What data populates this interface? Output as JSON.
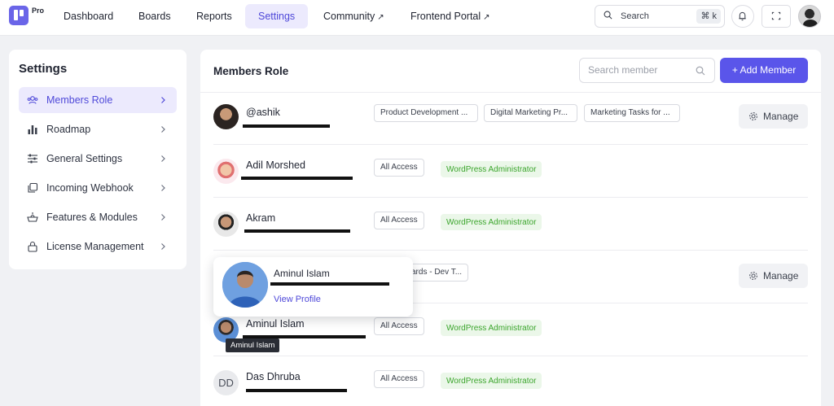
{
  "topbar": {
    "logo_badge": "Pro",
    "nav": [
      {
        "label": "Dashboard"
      },
      {
        "label": "Boards"
      },
      {
        "label": "Reports"
      },
      {
        "label": "Settings",
        "active": true
      },
      {
        "label": "Community",
        "external": "↗"
      },
      {
        "label": "Frontend Portal",
        "external": "↗"
      }
    ],
    "search_label": "Search",
    "search_shortcut": "⌘ k",
    "icons": [
      "bell-icon",
      "expand-icon",
      "user-avatar"
    ]
  },
  "sidebar": {
    "title": "Settings",
    "items": [
      {
        "label": "Members Role",
        "icon": "members-icon",
        "active": true
      },
      {
        "label": "Roadmap",
        "icon": "roadmap-icon"
      },
      {
        "label": "General Settings",
        "icon": "sliders-icon"
      },
      {
        "label": "Incoming Webhook",
        "icon": "webhook-icon"
      },
      {
        "label": "Features & Modules",
        "icon": "modules-icon"
      },
      {
        "label": "License Management",
        "icon": "lock-icon"
      }
    ]
  },
  "main": {
    "title": "Members Role",
    "search_placeholder": "Search member",
    "add_button": "+ Add Member",
    "manage_label": "Manage",
    "members": [
      {
        "name": "@ashik",
        "tags": [
          "Product Development ...",
          "Digital Marketing Pr...",
          "Marketing Tasks for ..."
        ],
        "tag_style": "outline",
        "manage": true
      },
      {
        "name": "Adil Morshed",
        "tags": [
          "All Access"
        ],
        "role": "WordPress Administrator"
      },
      {
        "name": "Akram",
        "tags": [
          "All Access"
        ],
        "role": "WordPress Administrator"
      },
      {
        "name": "",
        "tags": [
          "ards - Dev T..."
        ],
        "manage": true
      },
      {
        "name": "Aminul Islam",
        "tags": [
          "All Access"
        ],
        "role": "WordPress Administrator"
      },
      {
        "name": "Das Dhruba",
        "initials": "DD",
        "tags": [
          "All Access"
        ],
        "role": "WordPress Administrator"
      }
    ]
  },
  "popover": {
    "name": "Aminul Islam",
    "link": "View Profile"
  },
  "tooltip": "Aminul Islam",
  "colors": {
    "accent": "#5a55ea",
    "accent_soft": "#eceafd",
    "green_text": "#3ba52c",
    "green_bg": "#ebf7e9"
  }
}
